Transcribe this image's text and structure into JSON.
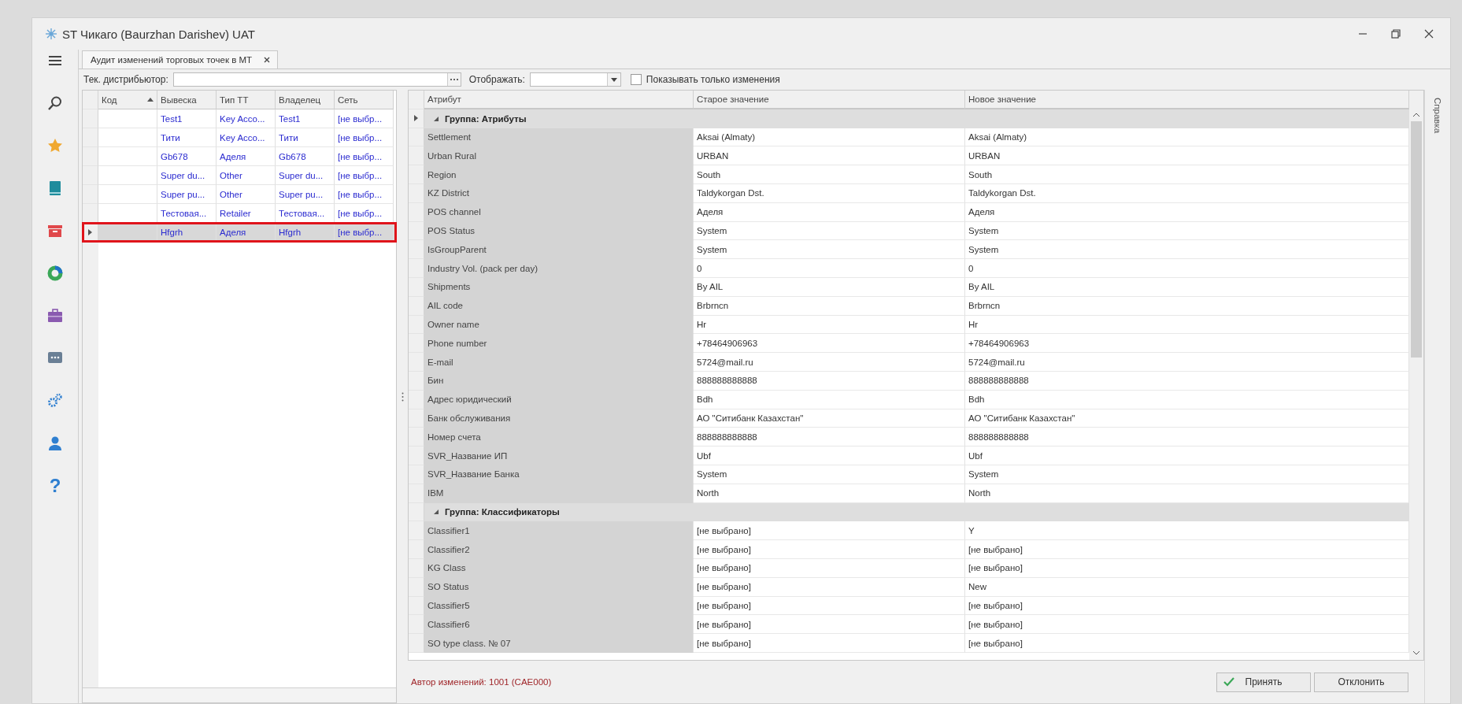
{
  "window": {
    "title": "ST Чикаго (Baurzhan Darishev) UAT"
  },
  "nav": {
    "help_glyph": "?"
  },
  "tabs": [
    {
      "label": "Аудит изменений торговых точек в МТ",
      "selected": true
    }
  ],
  "filters": {
    "distributor_label": "Тек. дистрибьютор:",
    "display_label": "Отображать:",
    "only_changes": {
      "label": "Показывать только изменения",
      "checked": false
    }
  },
  "outlets_table": {
    "columns": [
      {
        "label": "Код",
        "sorted": true
      },
      {
        "label": "Вывеска",
        "sorted": false
      },
      {
        "label": "Тип ТТ",
        "sorted": false
      },
      {
        "label": "Владелец",
        "sorted": false
      },
      {
        "label": "Сеть",
        "sorted": false
      }
    ],
    "rows": [
      {
        "cells": [
          "",
          "Test1",
          "Key Acco...",
          "Test1",
          "[не выбр..."
        ],
        "selected": false
      },
      {
        "cells": [
          "",
          "Тити",
          "Key Acco...",
          "Тити",
          "[не выбр..."
        ],
        "selected": false
      },
      {
        "cells": [
          "",
          "Gb678",
          "Аделя",
          "Gb678",
          "[не выбр..."
        ],
        "selected": false
      },
      {
        "cells": [
          "",
          "Super du...",
          "Other",
          "Super du...",
          "[не выбр..."
        ],
        "selected": false
      },
      {
        "cells": [
          "",
          "Super pu...",
          "Other",
          "Super pu...",
          "[не выбр..."
        ],
        "selected": false
      },
      {
        "cells": [
          "",
          "Тестовая...",
          "Retailer",
          "Тестовая...",
          "[не выбр..."
        ],
        "selected": false
      },
      {
        "cells": [
          "",
          "Hfgrh",
          "Аделя",
          "Hfgrh",
          "[не выбр..."
        ],
        "selected": true
      }
    ]
  },
  "attributes_table": {
    "columns": [
      "Атрибут",
      "Старое значение",
      "Новое значение"
    ],
    "groups": [
      {
        "title": "Группа: Атрибуты",
        "expanded": true,
        "focused": true,
        "rows": [
          {
            "attribute": "Settlement",
            "old": "Aksai (Almaty)",
            "new": "Aksai (Almaty)"
          },
          {
            "attribute": "Urban Rural",
            "old": "URBAN",
            "new": "URBAN"
          },
          {
            "attribute": "Region",
            "old": "South",
            "new": "South"
          },
          {
            "attribute": "KZ District",
            "old": "Taldykorgan Dst.",
            "new": "Taldykorgan Dst."
          },
          {
            "attribute": "POS channel",
            "old": "Аделя",
            "new": "Аделя"
          },
          {
            "attribute": "POS Status",
            "old": "System",
            "new": "System"
          },
          {
            "attribute": "IsGroupParent",
            "old": "System",
            "new": "System"
          },
          {
            "attribute": "Industry Vol. (pack per day)",
            "old": "0",
            "new": "0"
          },
          {
            "attribute": "Shipments",
            "old": "By AIL",
            "new": "By AIL"
          },
          {
            "attribute": "AIL code",
            "old": "Brbrncn",
            "new": "Brbrncn"
          },
          {
            "attribute": "Owner name",
            "old": "Hr",
            "new": "Hr"
          },
          {
            "attribute": "Phone number",
            "old": "+78464906963",
            "new": "+78464906963"
          },
          {
            "attribute": "E-mail",
            "old": "5724@mail.ru",
            "new": "5724@mail.ru"
          },
          {
            "attribute": "Бин",
            "old": "888888888888",
            "new": "888888888888"
          },
          {
            "attribute": "Адрес юридический",
            "old": "Bdh",
            "new": "Bdh"
          },
          {
            "attribute": "Банк обслуживания",
            "old": "АО \"Ситибанк Казахстан\"",
            "new": "АО \"Ситибанк Казахстан\""
          },
          {
            "attribute": "Номер счета",
            "old": "888888888888",
            "new": "888888888888"
          },
          {
            "attribute": "SVR_Название ИП",
            "old": "Ubf",
            "new": "Ubf"
          },
          {
            "attribute": "SVR_Название Банка",
            "old": "System",
            "new": "System"
          },
          {
            "attribute": "IBM",
            "old": "North",
            "new": "North"
          }
        ]
      },
      {
        "title": "Группа: Классификаторы",
        "expanded": true,
        "focused": false,
        "rows": [
          {
            "attribute": "Classifier1",
            "old": "[не выбрано]",
            "new": "Y"
          },
          {
            "attribute": "Classifier2",
            "old": "[не выбрано]",
            "new": "[не выбрано]"
          },
          {
            "attribute": "KG Class",
            "old": "[не выбрано]",
            "new": "[не выбрано]"
          },
          {
            "attribute": "SO Status",
            "old": "[не выбрано]",
            "new": "New"
          },
          {
            "attribute": "Classifier5",
            "old": "[не выбрано]",
            "new": "[не выбрано]"
          },
          {
            "attribute": "Classifier6",
            "old": "[не выбрано]",
            "new": "[не выбрано]"
          },
          {
            "attribute": "SO type class. № 07",
            "old": "[не выбрано]",
            "new": "[не выбрано]"
          }
        ]
      }
    ]
  },
  "side_panel": {
    "label": "Справка"
  },
  "footer": {
    "author": "Автор изменений: 1001 (CAE000)",
    "buttons": [
      {
        "label": "Принять",
        "kind": "accept"
      },
      {
        "label": "Отклонить",
        "kind": "reject"
      }
    ]
  }
}
